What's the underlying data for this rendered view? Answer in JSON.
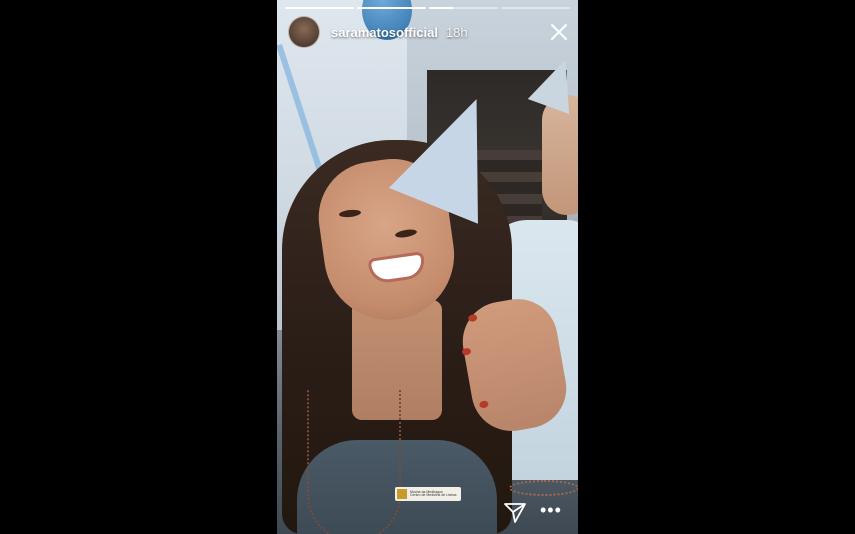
{
  "story": {
    "username": "saramatosofficial",
    "time_ago": "18h",
    "progress": {
      "segments": [
        1,
        1,
        0.35,
        0
      ]
    },
    "close_icon": "close-icon",
    "send_icon": "paper-plane-icon",
    "more_icon": "more-dots-icon",
    "more_label": "•••",
    "sticker": {
      "line1": "Mocha da Medbagus",
      "line2": "Centro de Medicina de Lisboa"
    }
  }
}
